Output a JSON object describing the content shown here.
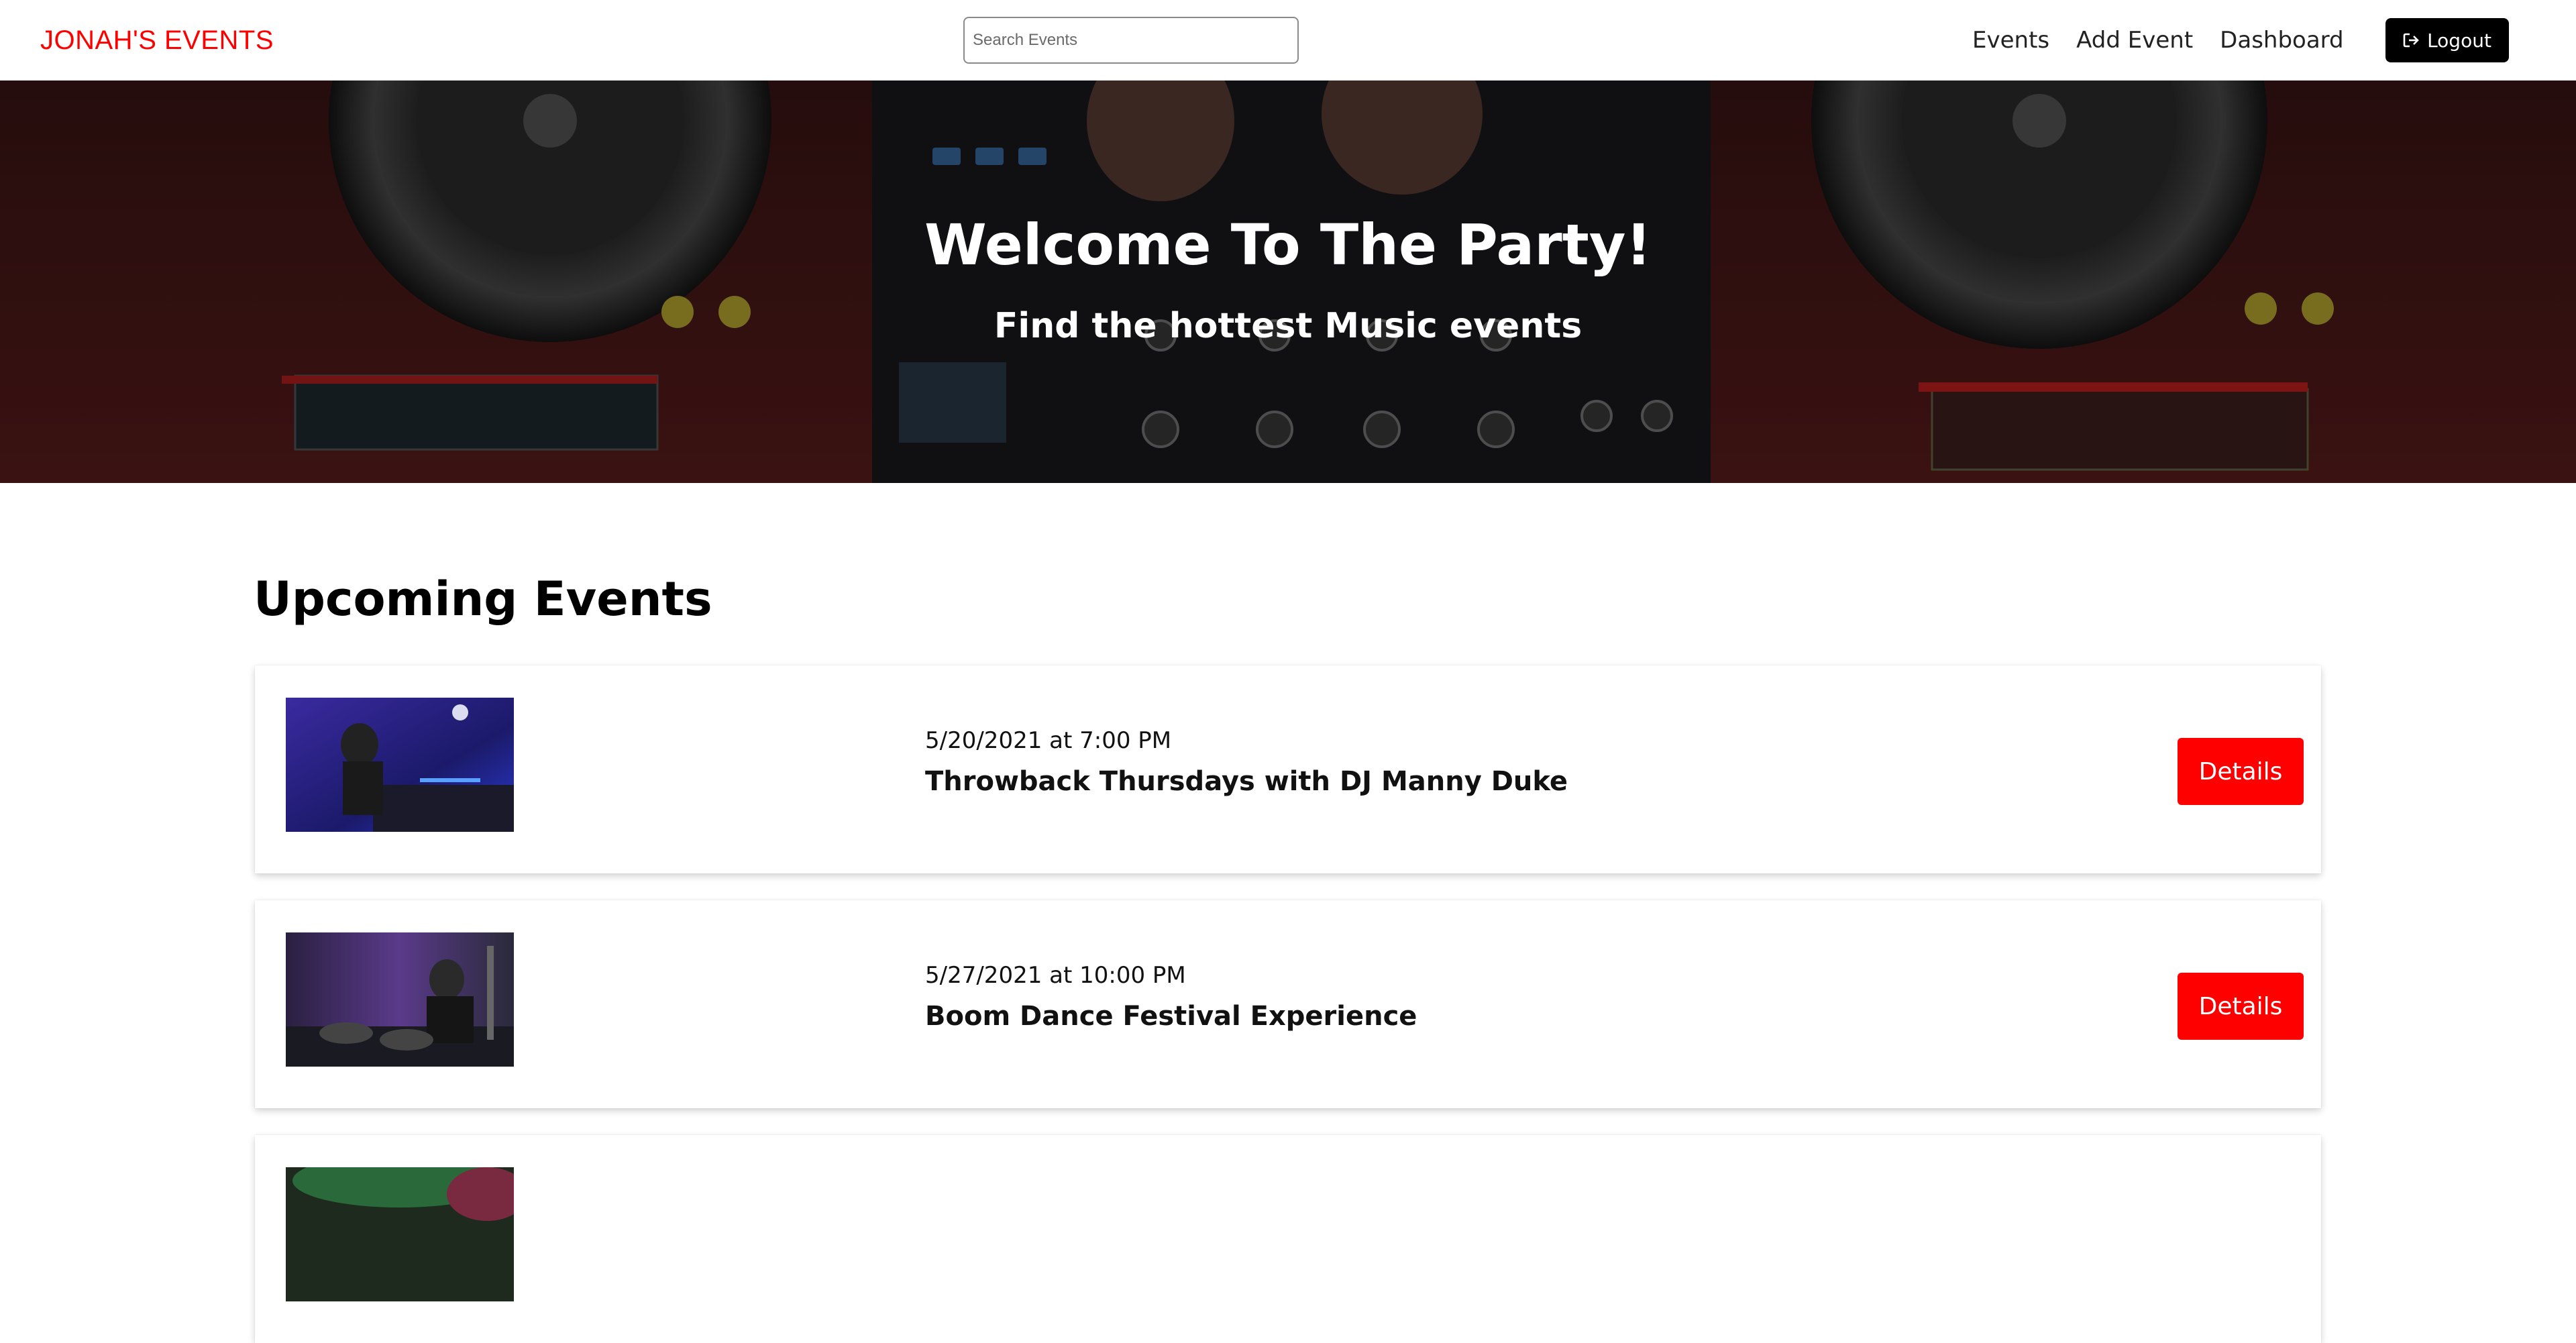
{
  "navbar": {
    "brand": "JONAH'S EVENTS",
    "search_placeholder": "Search Events",
    "links": [
      "Events",
      "Add Event",
      "Dashboard"
    ],
    "logout_label": "Logout",
    "logout_icon": "logout-icon"
  },
  "hero": {
    "title": "Welcome To The Party!",
    "subtitle": "Find the hottest Music events"
  },
  "events_section": {
    "heading": "Upcoming Events",
    "events": [
      {
        "date": "5/20/2021 at 7:00 PM",
        "title": "Throwback Thursdays with DJ Manny Duke",
        "button": "Details"
      },
      {
        "date": "5/27/2021 at 10:00 PM",
        "title": "Boom Dance Festival Experience",
        "button": "Details"
      },
      {
        "date": "",
        "title": "",
        "button": ""
      }
    ]
  },
  "colors": {
    "brand": "#ff0000",
    "button_primary": "#ff0000",
    "logout_bg": "#000000"
  }
}
